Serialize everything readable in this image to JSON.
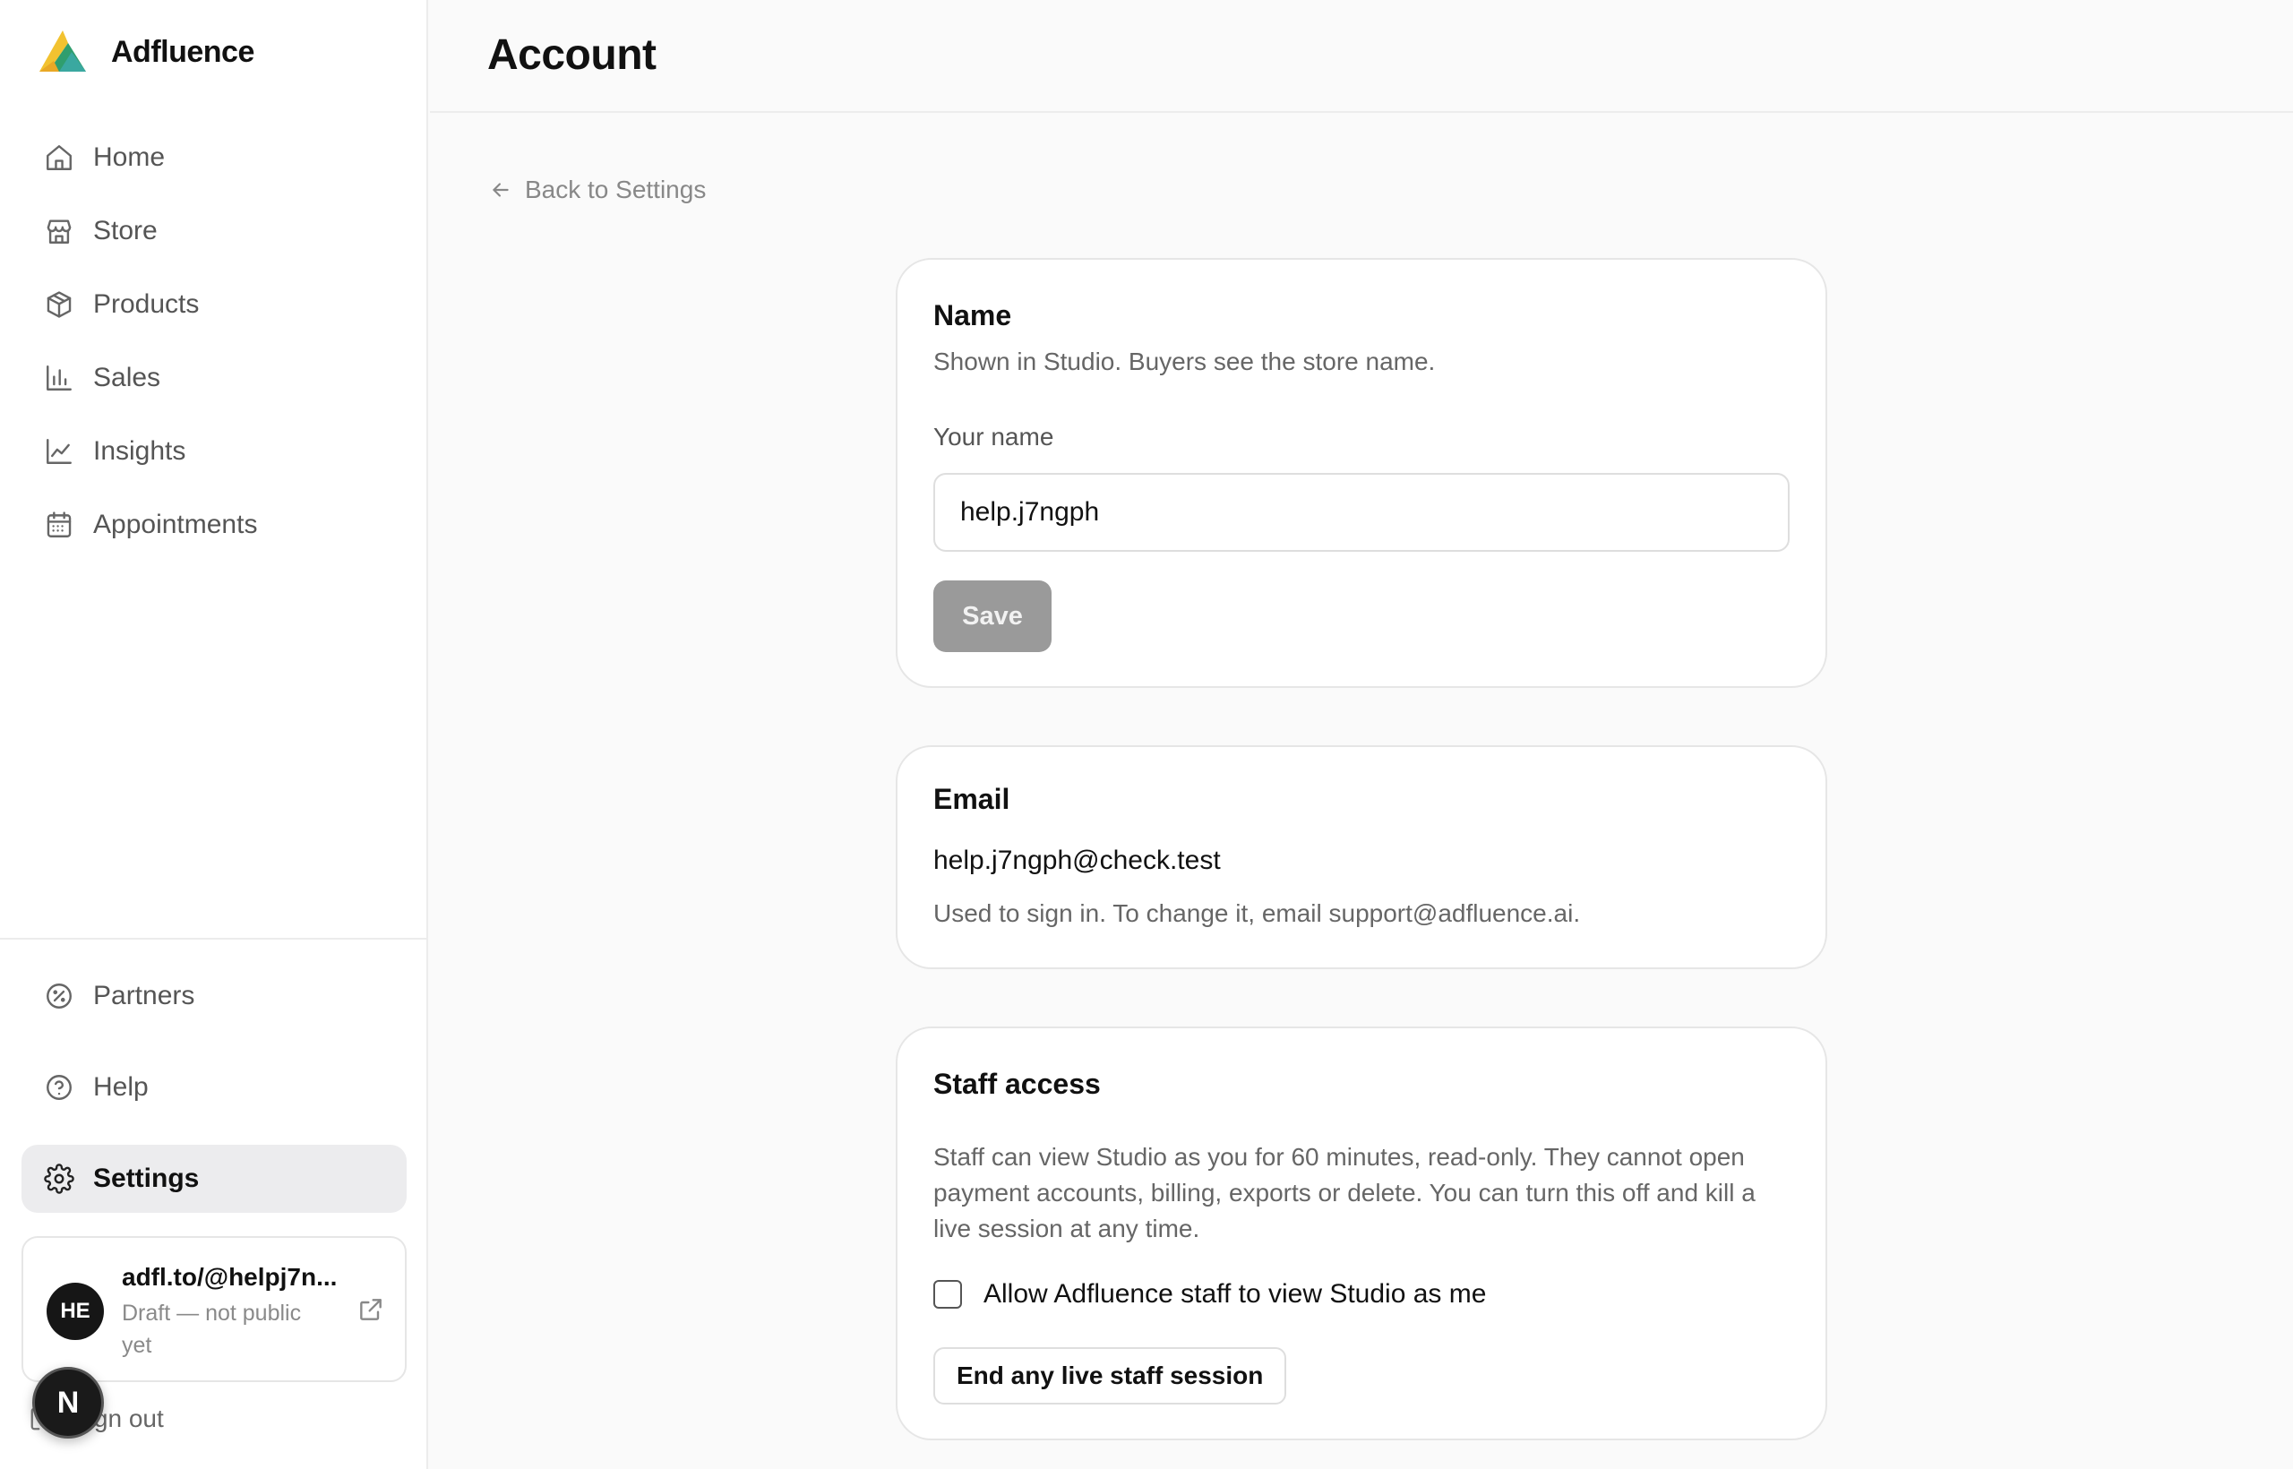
{
  "app": {
    "brand_name": "Adfluence"
  },
  "sidebar": {
    "items": [
      {
        "label": "Home",
        "icon": "home-icon"
      },
      {
        "label": "Store",
        "icon": "store-icon"
      },
      {
        "label": "Products",
        "icon": "box-icon"
      },
      {
        "label": "Sales",
        "icon": "bar-chart-icon"
      },
      {
        "label": "Insights",
        "icon": "line-chart-icon"
      },
      {
        "label": "Appointments",
        "icon": "calendar-icon"
      }
    ],
    "bottom_items": [
      {
        "label": "Partners",
        "icon": "percent-badge-icon"
      },
      {
        "label": "Help",
        "icon": "help-circle-icon"
      },
      {
        "label": "Settings",
        "icon": "gear-icon",
        "active": true
      }
    ],
    "store_card": {
      "avatar_initials": "HE",
      "url": "adfl.to/@helpj7n...",
      "status": "Draft — not public yet"
    },
    "sign_out_label": "Sign out",
    "fab_letter": "N"
  },
  "header": {
    "title": "Account"
  },
  "back_link": {
    "label": "Back to Settings"
  },
  "name_card": {
    "title": "Name",
    "description": "Shown in Studio. Buyers see the store name.",
    "field_label": "Your name",
    "field_value": "help.j7ngph",
    "save_label": "Save"
  },
  "email_card": {
    "title": "Email",
    "email": "help.j7ngph@check.test",
    "description": "Used to sign in. To change it, email support@adfluence.ai."
  },
  "staff_card": {
    "title": "Staff access",
    "description": "Staff can view Studio as you for 60 minutes, read-only. They cannot open payment accounts, billing, exports or delete. You can turn this off and kill a live session at any time.",
    "checkbox_label": "Allow Adfluence staff to view Studio as me",
    "checkbox_checked": false,
    "end_session_label": "End any live staff session"
  },
  "colors": {
    "page_bg": "#fafafa",
    "card_bg": "#ffffff",
    "active_nav_bg": "#ececee",
    "save_button_disabled": "#9a9a9a",
    "logo_yellow": "#f2c230",
    "logo_green": "#2f9e6e",
    "logo_teal": "#3aa8a0"
  }
}
